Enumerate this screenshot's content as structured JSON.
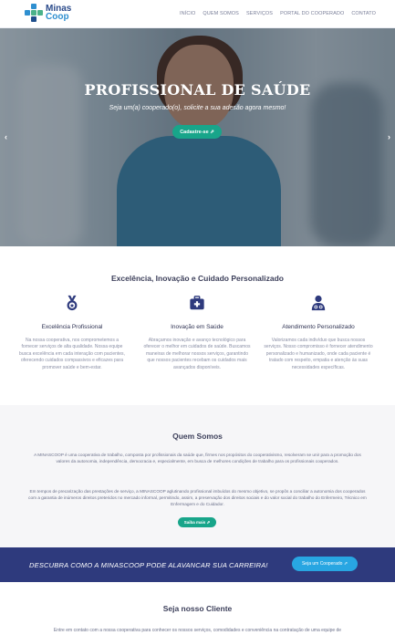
{
  "brand": {
    "line1": "Minas",
    "line2": "Coop"
  },
  "nav": {
    "items": [
      {
        "label": "INÍCIO"
      },
      {
        "label": "QUEM SOMOS"
      },
      {
        "label": "SERVIÇOS"
      },
      {
        "label": "PORTAL DO COOPERADO"
      },
      {
        "label": "CONTATO"
      }
    ]
  },
  "hero": {
    "title": "PROFISSIONAL DE SAÚDE",
    "subtitle": "Seja um(a) cooperado(o), solicite a sua adesão agora mesmo!",
    "button": "Cadastre-se ⇗",
    "prev_icon": "chevron-left-icon",
    "next_icon": "chevron-right-icon"
  },
  "features": {
    "title": "Excelência, Inovação e Cuidado Personalizado",
    "items": [
      {
        "icon": "medal-icon",
        "heading": "Excelência Profissional",
        "text": "Na nossa cooperativa, nos comprometemos a fornecer serviços de alta qualidade. Nossa equipe busca excelência em cada interação com pacientes, oferecendo cuidados compassivos e eficazes para promover saúde e bem-estar."
      },
      {
        "icon": "briefcase-medical-icon",
        "heading": "Inovação em Saúde",
        "text": "Abraçamos inovação e avanço tecnológico para oferecer o melhor em cuidados de saúde. Buscamos maneiras de melhorar nossos serviços, garantindo que nossos pacientes recebam os cuidados mais avançados disponíveis."
      },
      {
        "icon": "user-doctor-icon",
        "heading": "Atendimento Personalizado",
        "text": "Valorizamos cada indivíduo que busca nossos serviços. Nosso compromisso é fornecer atendimento personalizado e humanizado, onde cada paciente é tratado com respeito, empatia e atenção às suas necessidades específicas."
      }
    ]
  },
  "quem_somos": {
    "title": "Quem Somos",
    "p1": "A MINASCOOP é uma cooperativa de trabalho, composta por profissionais da saúde que, firmes nos propósitos do cooperativismo, resolveram se unir para a promoção dos valores da autonomia, independência, democracia e, especialmente, em busca de melhores condições de trabalho para os profissionais cooperados.",
    "p2": "Em tempos de precarização das prestações de serviço, a MINASCOOP aglutinando profissional imbuídos do mesmo objetivo, se propôs a conciliar a autonomia dos cooperados com a garantia de inúmeros direitos preteridos no mercado informal, permitindo, assim, a preservação dos direitos sociais e do valor social do trabalho do Enfermeiro, Técnico em Enfermagem e do Cuidador.",
    "button": "Saiba mais ⇗"
  },
  "cta": {
    "text": "DESCUBRA COMO A MINASCOOP PODE ALAVANCAR SUA CARREIRA!",
    "button": "Seja um Cooperado ⇗"
  },
  "cliente": {
    "title": "Seja nosso Cliente",
    "text": "Entre em contato com a nossa cooperativa para conhecer os nossos serviços, comodidades e conveniência na contratação de uma equipe de"
  },
  "colors": {
    "accent": "#18a58a",
    "navy": "#2e3a7d",
    "blue": "#28a6e2"
  }
}
